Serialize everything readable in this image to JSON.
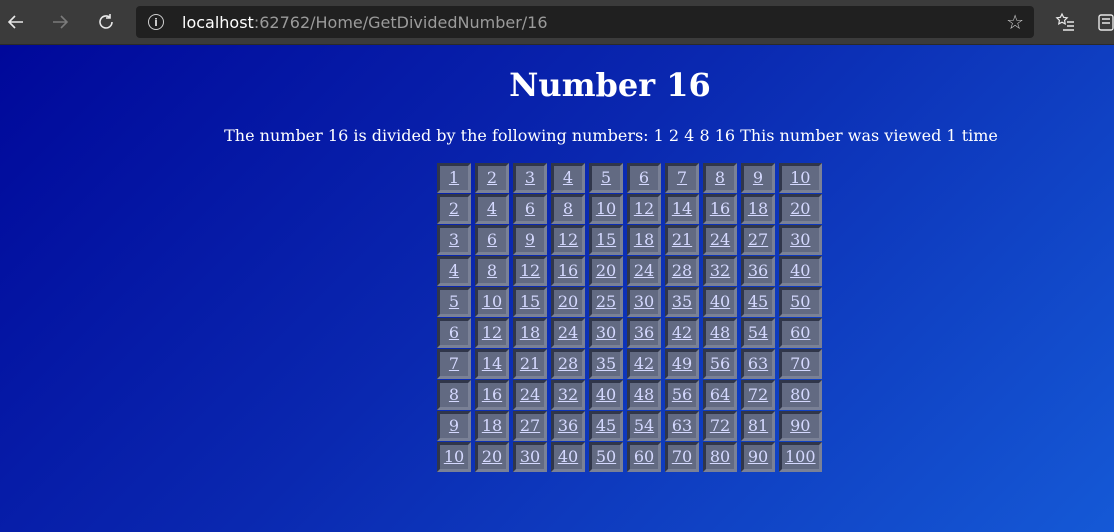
{
  "browser": {
    "url_host": "localhost",
    "url_rest": ":62762/Home/GetDividedNumber/16",
    "icons": [
      "back-arrow-icon",
      "forward-arrow-icon",
      "refresh-icon",
      "info-icon",
      "star-icon",
      "favorites-icon",
      "collections-icon"
    ]
  },
  "page": {
    "title": "Number 16",
    "description": "The number 16 is divided by the following numbers: 1 2 4 8 16 This number was viewed 1 time",
    "table": [
      [
        "1",
        "2",
        "3",
        "4",
        "5",
        "6",
        "7",
        "8",
        "9",
        "10"
      ],
      [
        "2",
        "4",
        "6",
        "8",
        "10",
        "12",
        "14",
        "16",
        "18",
        "20"
      ],
      [
        "3",
        "6",
        "9",
        "12",
        "15",
        "18",
        "21",
        "24",
        "27",
        "30"
      ],
      [
        "4",
        "8",
        "12",
        "16",
        "20",
        "24",
        "28",
        "32",
        "36",
        "40"
      ],
      [
        "5",
        "10",
        "15",
        "20",
        "25",
        "30",
        "35",
        "40",
        "45",
        "50"
      ],
      [
        "6",
        "12",
        "18",
        "24",
        "30",
        "36",
        "42",
        "48",
        "54",
        "60"
      ],
      [
        "7",
        "14",
        "21",
        "28",
        "35",
        "42",
        "49",
        "56",
        "63",
        "70"
      ],
      [
        "8",
        "16",
        "24",
        "32",
        "40",
        "48",
        "56",
        "64",
        "72",
        "80"
      ],
      [
        "9",
        "18",
        "27",
        "36",
        "45",
        "54",
        "63",
        "72",
        "81",
        "90"
      ],
      [
        "10",
        "20",
        "30",
        "40",
        "50",
        "60",
        "70",
        "80",
        "90",
        "100"
      ]
    ],
    "colors": {
      "background_start": "#00089a",
      "background_end": "#1559d6",
      "cell_background": "#626a82",
      "link": "#d5d9ff"
    }
  }
}
